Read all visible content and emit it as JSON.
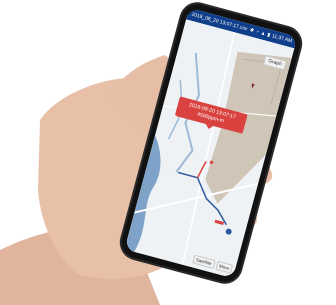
{
  "statusbar": {
    "title": "2018_08_20 13:07:17.csv",
    "time": "11:37 AM"
  },
  "map": {
    "graph_label": "Graph",
    "popup_line1": "2018-08-20 13:07:17",
    "popup_line2": "4500ppm-m",
    "satellite_label": "Satellite",
    "more_label": "More"
  },
  "colors": {
    "statusbar": "#0f3f8a",
    "popup": "#d9423f",
    "building": "#cfc6b8",
    "water": "#7fa3c8"
  }
}
